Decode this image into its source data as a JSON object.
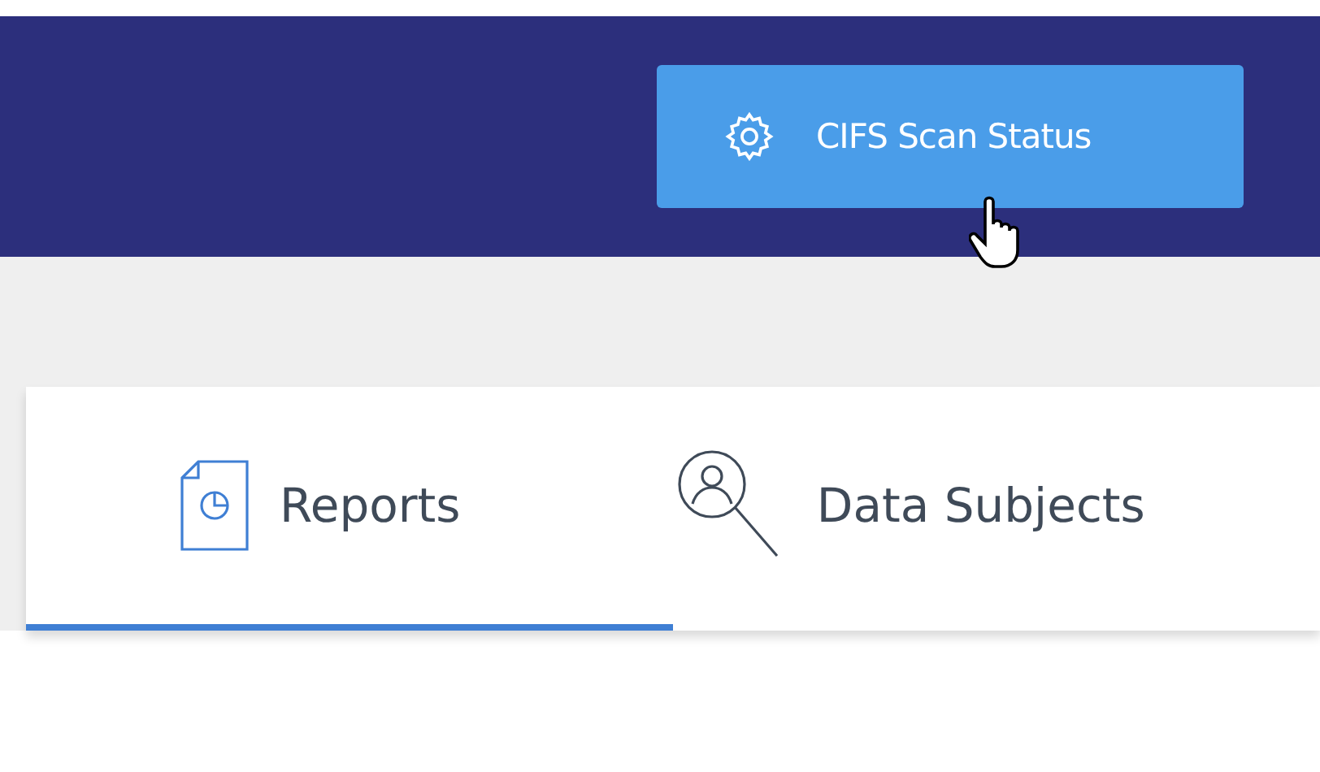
{
  "header": {
    "button": {
      "label": "CIFS Scan Status"
    }
  },
  "tabs": [
    {
      "label": "Reports",
      "kind": "report",
      "selected": true
    },
    {
      "label": "Data Subjects",
      "kind": "subjects",
      "selected": false
    }
  ]
}
